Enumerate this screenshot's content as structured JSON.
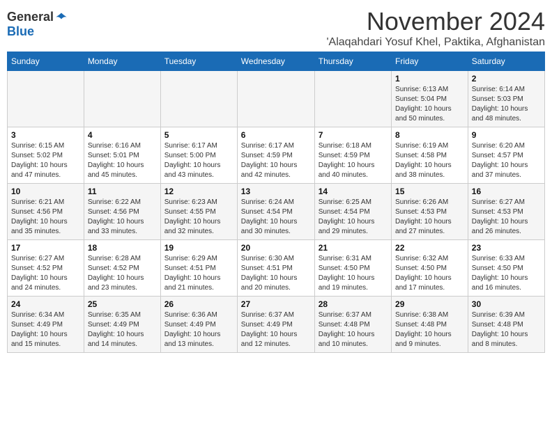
{
  "logo": {
    "general": "General",
    "blue": "Blue"
  },
  "title": "November 2024",
  "location": "'Alaqahdari Yosuf Khel, Paktika, Afghanistan",
  "headers": [
    "Sunday",
    "Monday",
    "Tuesday",
    "Wednesday",
    "Thursday",
    "Friday",
    "Saturday"
  ],
  "weeks": [
    [
      {
        "day": "",
        "sunrise": "",
        "sunset": "",
        "daylight": ""
      },
      {
        "day": "",
        "sunrise": "",
        "sunset": "",
        "daylight": ""
      },
      {
        "day": "",
        "sunrise": "",
        "sunset": "",
        "daylight": ""
      },
      {
        "day": "",
        "sunrise": "",
        "sunset": "",
        "daylight": ""
      },
      {
        "day": "",
        "sunrise": "",
        "sunset": "",
        "daylight": ""
      },
      {
        "day": "1",
        "sunrise": "Sunrise: 6:13 AM",
        "sunset": "Sunset: 5:04 PM",
        "daylight": "Daylight: 10 hours and 50 minutes."
      },
      {
        "day": "2",
        "sunrise": "Sunrise: 6:14 AM",
        "sunset": "Sunset: 5:03 PM",
        "daylight": "Daylight: 10 hours and 48 minutes."
      }
    ],
    [
      {
        "day": "3",
        "sunrise": "Sunrise: 6:15 AM",
        "sunset": "Sunset: 5:02 PM",
        "daylight": "Daylight: 10 hours and 47 minutes."
      },
      {
        "day": "4",
        "sunrise": "Sunrise: 6:16 AM",
        "sunset": "Sunset: 5:01 PM",
        "daylight": "Daylight: 10 hours and 45 minutes."
      },
      {
        "day": "5",
        "sunrise": "Sunrise: 6:17 AM",
        "sunset": "Sunset: 5:00 PM",
        "daylight": "Daylight: 10 hours and 43 minutes."
      },
      {
        "day": "6",
        "sunrise": "Sunrise: 6:17 AM",
        "sunset": "Sunset: 4:59 PM",
        "daylight": "Daylight: 10 hours and 42 minutes."
      },
      {
        "day": "7",
        "sunrise": "Sunrise: 6:18 AM",
        "sunset": "Sunset: 4:59 PM",
        "daylight": "Daylight: 10 hours and 40 minutes."
      },
      {
        "day": "8",
        "sunrise": "Sunrise: 6:19 AM",
        "sunset": "Sunset: 4:58 PM",
        "daylight": "Daylight: 10 hours and 38 minutes."
      },
      {
        "day": "9",
        "sunrise": "Sunrise: 6:20 AM",
        "sunset": "Sunset: 4:57 PM",
        "daylight": "Daylight: 10 hours and 37 minutes."
      }
    ],
    [
      {
        "day": "10",
        "sunrise": "Sunrise: 6:21 AM",
        "sunset": "Sunset: 4:56 PM",
        "daylight": "Daylight: 10 hours and 35 minutes."
      },
      {
        "day": "11",
        "sunrise": "Sunrise: 6:22 AM",
        "sunset": "Sunset: 4:56 PM",
        "daylight": "Daylight: 10 hours and 33 minutes."
      },
      {
        "day": "12",
        "sunrise": "Sunrise: 6:23 AM",
        "sunset": "Sunset: 4:55 PM",
        "daylight": "Daylight: 10 hours and 32 minutes."
      },
      {
        "day": "13",
        "sunrise": "Sunrise: 6:24 AM",
        "sunset": "Sunset: 4:54 PM",
        "daylight": "Daylight: 10 hours and 30 minutes."
      },
      {
        "day": "14",
        "sunrise": "Sunrise: 6:25 AM",
        "sunset": "Sunset: 4:54 PM",
        "daylight": "Daylight: 10 hours and 29 minutes."
      },
      {
        "day": "15",
        "sunrise": "Sunrise: 6:26 AM",
        "sunset": "Sunset: 4:53 PM",
        "daylight": "Daylight: 10 hours and 27 minutes."
      },
      {
        "day": "16",
        "sunrise": "Sunrise: 6:27 AM",
        "sunset": "Sunset: 4:53 PM",
        "daylight": "Daylight: 10 hours and 26 minutes."
      }
    ],
    [
      {
        "day": "17",
        "sunrise": "Sunrise: 6:27 AM",
        "sunset": "Sunset: 4:52 PM",
        "daylight": "Daylight: 10 hours and 24 minutes."
      },
      {
        "day": "18",
        "sunrise": "Sunrise: 6:28 AM",
        "sunset": "Sunset: 4:52 PM",
        "daylight": "Daylight: 10 hours and 23 minutes."
      },
      {
        "day": "19",
        "sunrise": "Sunrise: 6:29 AM",
        "sunset": "Sunset: 4:51 PM",
        "daylight": "Daylight: 10 hours and 21 minutes."
      },
      {
        "day": "20",
        "sunrise": "Sunrise: 6:30 AM",
        "sunset": "Sunset: 4:51 PM",
        "daylight": "Daylight: 10 hours and 20 minutes."
      },
      {
        "day": "21",
        "sunrise": "Sunrise: 6:31 AM",
        "sunset": "Sunset: 4:50 PM",
        "daylight": "Daylight: 10 hours and 19 minutes."
      },
      {
        "day": "22",
        "sunrise": "Sunrise: 6:32 AM",
        "sunset": "Sunset: 4:50 PM",
        "daylight": "Daylight: 10 hours and 17 minutes."
      },
      {
        "day": "23",
        "sunrise": "Sunrise: 6:33 AM",
        "sunset": "Sunset: 4:50 PM",
        "daylight": "Daylight: 10 hours and 16 minutes."
      }
    ],
    [
      {
        "day": "24",
        "sunrise": "Sunrise: 6:34 AM",
        "sunset": "Sunset: 4:49 PM",
        "daylight": "Daylight: 10 hours and 15 minutes."
      },
      {
        "day": "25",
        "sunrise": "Sunrise: 6:35 AM",
        "sunset": "Sunset: 4:49 PM",
        "daylight": "Daylight: 10 hours and 14 minutes."
      },
      {
        "day": "26",
        "sunrise": "Sunrise: 6:36 AM",
        "sunset": "Sunset: 4:49 PM",
        "daylight": "Daylight: 10 hours and 13 minutes."
      },
      {
        "day": "27",
        "sunrise": "Sunrise: 6:37 AM",
        "sunset": "Sunset: 4:49 PM",
        "daylight": "Daylight: 10 hours and 12 minutes."
      },
      {
        "day": "28",
        "sunrise": "Sunrise: 6:37 AM",
        "sunset": "Sunset: 4:48 PM",
        "daylight": "Daylight: 10 hours and 10 minutes."
      },
      {
        "day": "29",
        "sunrise": "Sunrise: 6:38 AM",
        "sunset": "Sunset: 4:48 PM",
        "daylight": "Daylight: 10 hours and 9 minutes."
      },
      {
        "day": "30",
        "sunrise": "Sunrise: 6:39 AM",
        "sunset": "Sunset: 4:48 PM",
        "daylight": "Daylight: 10 hours and 8 minutes."
      }
    ]
  ]
}
